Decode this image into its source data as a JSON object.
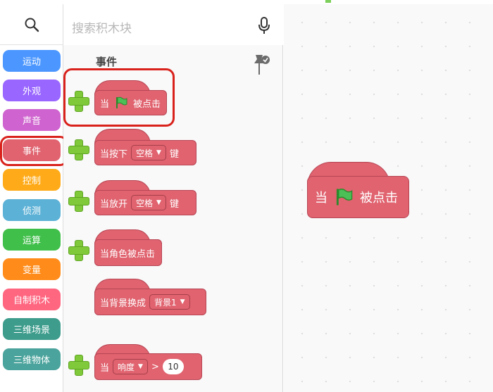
{
  "categories": [
    {
      "label": "运动",
      "color": "#4c97ff"
    },
    {
      "label": "外观",
      "color": "#9966ff"
    },
    {
      "label": "声音",
      "color": "#cf63cf"
    },
    {
      "label": "事件",
      "color": "#e0636f"
    },
    {
      "label": "控制",
      "color": "#ffab19"
    },
    {
      "label": "侦测",
      "color": "#5cb1d6"
    },
    {
      "label": "运算",
      "color": "#40bf4a"
    },
    {
      "label": "变量",
      "color": "#ff8c1a"
    },
    {
      "label": "自制积木",
      "color": "#ff6680"
    },
    {
      "label": "三维场景",
      "color": "#3d9c8c"
    },
    {
      "label": "三维物体",
      "color": "#4aa39c"
    }
  ],
  "search": {
    "placeholder": "搜索积木块"
  },
  "palette": {
    "section_title": "事件",
    "blocks": {
      "flag_clicked": {
        "prefix": "当",
        "suffix": "被点击"
      },
      "key_pressed": {
        "prefix": "当按下",
        "key": "空格",
        "suffix": "键"
      },
      "key_released": {
        "prefix": "当放开",
        "key": "空格",
        "suffix": "键"
      },
      "sprite_clicked": {
        "label": "当角色被点击"
      },
      "backdrop_switch": {
        "prefix": "当背景换成",
        "backdrop": "背景1"
      },
      "loudness": {
        "prefix": "当",
        "sensor": "响度",
        "op": ">",
        "value": "10"
      }
    }
  },
  "canvas": {
    "flag_block": {
      "prefix": "当",
      "suffix": "被点击"
    }
  },
  "colors": {
    "event_block": "#e0636f",
    "highlight": "#d9221c",
    "add_plus": "#80c93a"
  }
}
